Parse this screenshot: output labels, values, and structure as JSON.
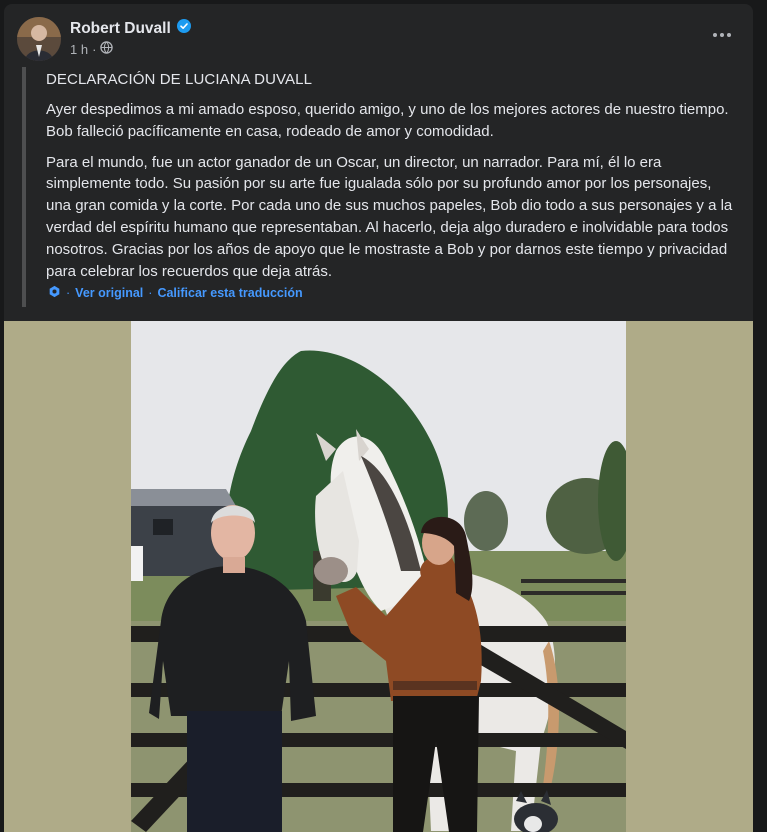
{
  "post": {
    "author": "Robert Duvall",
    "time": "1 h",
    "time_separator": "·",
    "title": "DECLARACIÓN DE LUCIANA DUVALL",
    "paragraph1": "Ayer despedimos a mi amado esposo, querido amigo, y uno de los mejores actores de nuestro tiempo. Bob falleció pacíficamente en casa, rodeado de amor y comodidad.",
    "paragraph2": "Para el mundo, fue un actor ganador de un Oscar, un director, un narrador. Para mí, él lo era simplemente todo. Su pasión por su arte fue igualada sólo por su profundo amor por los personajes, una gran comida y la corte. Por cada uno de sus muchos papeles, Bob dio todo a sus personajes y a la verdad del espíritu humano que representaban. Al hacerlo, deja algo duradero e inolvidable para todos nosotros. Gracias por los años de apoyo que le mostraste a Bob y por darnos este tiempo y privacidad para celebrar los recuerdos que deja atrás.",
    "see_original": "Ver original",
    "rate_translation": "Calificar esta traducción",
    "link_separator": "·"
  },
  "icons": {
    "verified": "verified-badge-icon",
    "audience": "globe-icon",
    "more": "more-options-icon",
    "translate": "translate-icon"
  },
  "colors": {
    "background": "#18191a",
    "card": "#242526",
    "text": "#e4e6eb",
    "secondary_text": "#b0b3b8",
    "link": "#4599ff",
    "photo_matte": "#afab88"
  }
}
